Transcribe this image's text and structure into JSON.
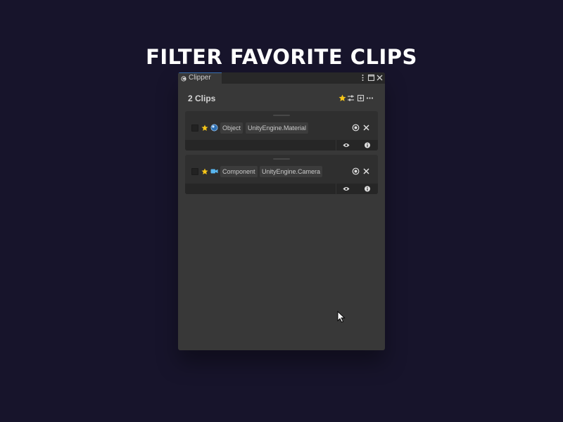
{
  "headline": "FILTER FAVORITE CLIPS",
  "window": {
    "tab_label": "Clipper",
    "header_title": "2 Clips"
  },
  "clips": [
    {
      "kind": "Object",
      "type": "UnityEngine.Material",
      "favorite": true,
      "type_icon": "material-sphere-icon"
    },
    {
      "kind": "Component",
      "type": "UnityEngine.Camera",
      "favorite": true,
      "type_icon": "camera-icon"
    }
  ],
  "colors": {
    "page_background": "#17142b",
    "window_background": "#383838",
    "card_background": "#2f2f2f",
    "favorite_star": "#f5c518",
    "tab_accent": "#3a72b0"
  }
}
